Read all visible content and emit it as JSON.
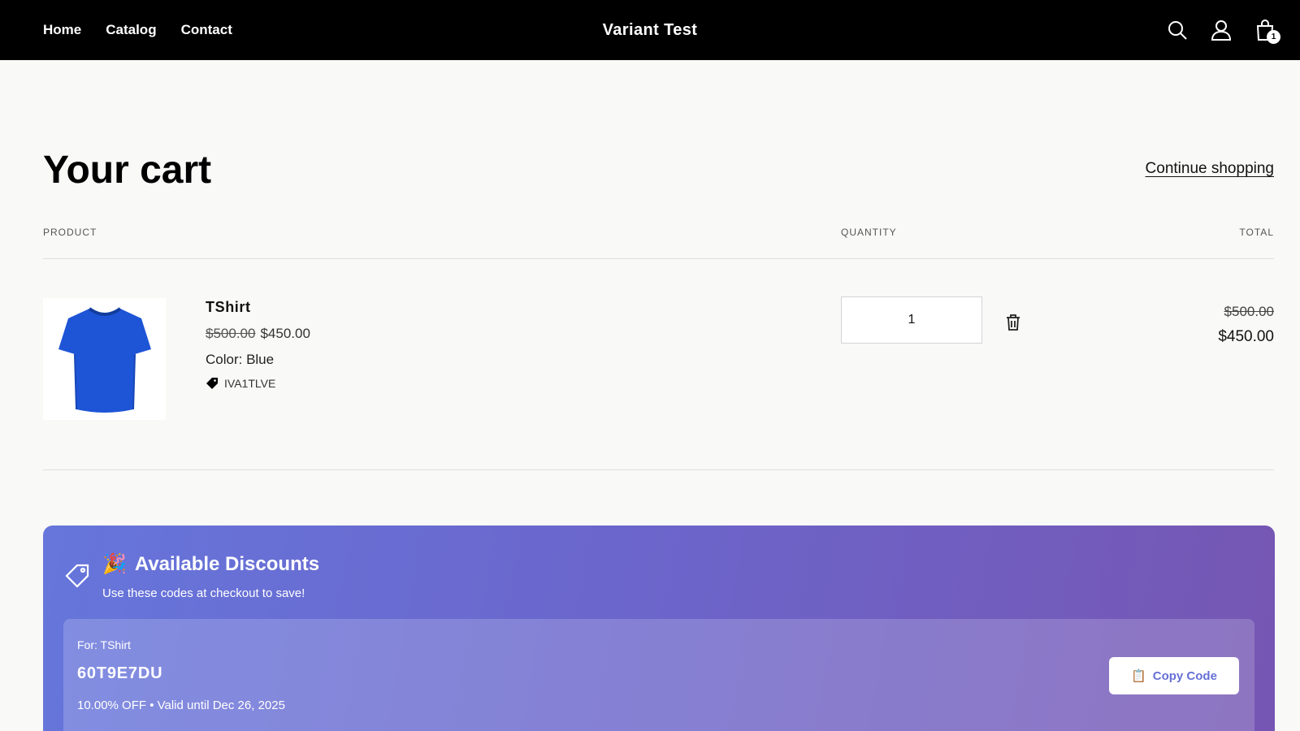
{
  "header": {
    "nav": [
      "Home",
      "Catalog",
      "Contact"
    ],
    "brand": "Variant Test",
    "cart_count": "1",
    "icons": [
      "search-icon",
      "account-icon",
      "cart-icon"
    ]
  },
  "cart": {
    "title": "Your cart",
    "continue_label": "Continue shopping",
    "columns": {
      "product": "PRODUCT",
      "quantity": "QUANTITY",
      "total": "TOTAL"
    },
    "items": [
      {
        "name": "TShirt",
        "compare_price": "$500.00",
        "price": "$450.00",
        "option": "Color: Blue",
        "discount_code": "IVA1TLVE",
        "quantity": "1",
        "total_compare": "$500.00",
        "total": "$450.00",
        "image_color": "#1e55d6"
      }
    ]
  },
  "discounts": {
    "emoji": "🎉",
    "title": "Available Discounts",
    "subtitle": "Use these codes at checkout to save!",
    "codes": [
      {
        "for": "For: TShirt",
        "code": "60T9E7DU",
        "meta": "10.00% OFF • Valid until Dec 26, 2025",
        "copy_icon": "📋",
        "copy_label": "Copy Code"
      }
    ]
  },
  "colors": {
    "header_bg": "#000000",
    "page_bg": "#f9f9f8",
    "accent": "#6670d6"
  }
}
